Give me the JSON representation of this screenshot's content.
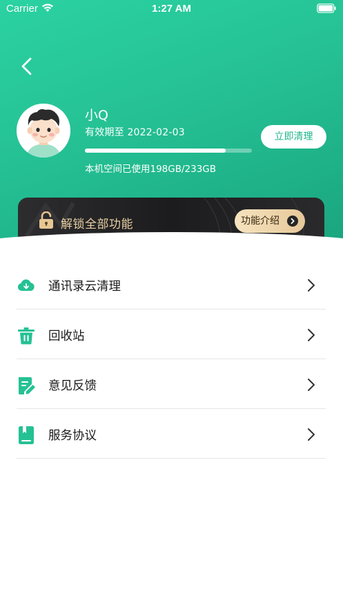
{
  "status_bar": {
    "carrier": "Carrier",
    "time": "1:27 AM"
  },
  "profile": {
    "name": "小Q",
    "expiry": "有效期至  2022-02-03",
    "storage_used_fraction": 0.845,
    "storage_text": "本机空间已使用198GB/233GB",
    "clean_button": "立即清理"
  },
  "banner": {
    "title": "解锁全部功能",
    "button": "功能介绍"
  },
  "menu": [
    {
      "label": "通讯录云清理",
      "icon": "cloud-download-icon"
    },
    {
      "label": "回收站",
      "icon": "trash-icon"
    },
    {
      "label": "意见反馈",
      "icon": "feedback-edit-icon"
    },
    {
      "label": "服务协议",
      "icon": "agreement-book-icon"
    }
  ],
  "colors": {
    "accent": "#25c194",
    "banner_text": "#e9cfa3"
  }
}
